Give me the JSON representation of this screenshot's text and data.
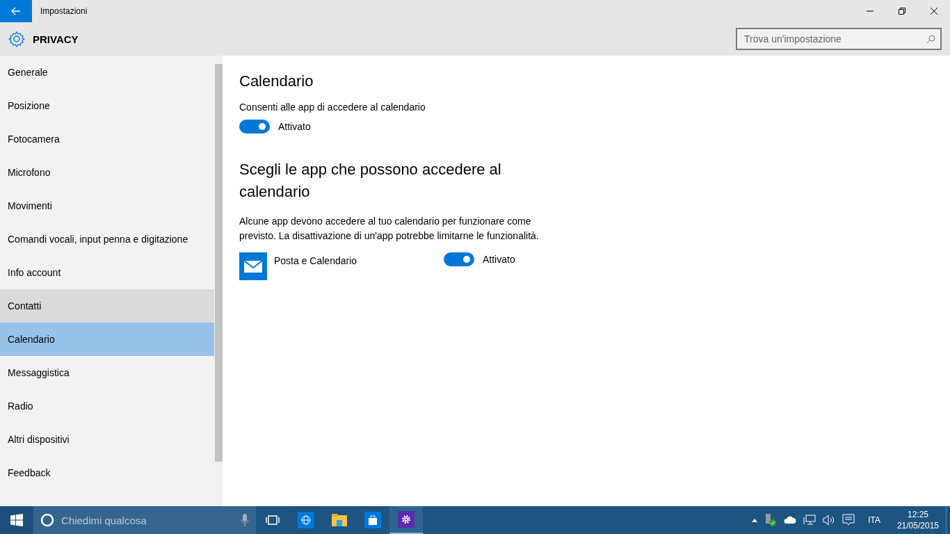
{
  "window": {
    "title": "Impostazioni"
  },
  "header": {
    "title": "PRIVACY",
    "search": {
      "placeholder": "Trova un'impostazione"
    }
  },
  "sidebar": {
    "items": [
      {
        "label": "Generale",
        "selected": false,
        "hovered": false
      },
      {
        "label": "Posizione",
        "selected": false,
        "hovered": false
      },
      {
        "label": "Fotocamera",
        "selected": false,
        "hovered": false
      },
      {
        "label": "Microfono",
        "selected": false,
        "hovered": false
      },
      {
        "label": "Movimenti",
        "selected": false,
        "hovered": false
      },
      {
        "label": "Comandi vocali, input penna e digitazione",
        "selected": false,
        "hovered": false
      },
      {
        "label": "Info account",
        "selected": false,
        "hovered": false
      },
      {
        "label": "Contatti",
        "selected": false,
        "hovered": true
      },
      {
        "label": "Calendario",
        "selected": true,
        "hovered": false
      },
      {
        "label": "Messaggistica",
        "selected": false,
        "hovered": false
      },
      {
        "label": "Radio",
        "selected": false,
        "hovered": false
      },
      {
        "label": "Altri dispositivi",
        "selected": false,
        "hovered": false
      },
      {
        "label": "Feedback",
        "selected": false,
        "hovered": false
      }
    ]
  },
  "content": {
    "title": "Calendario",
    "master": {
      "label": "Consenti alle app di accedere al calendario",
      "on": true,
      "state": "Attivato"
    },
    "subtitle": "Scegli le app che possono accedere al calendario",
    "description": "Alcune app devono accedere al tuo calendario per funzionare come previsto. La disattivazione di un'app potrebbe limitarne le funzionalità.",
    "apps": [
      {
        "name": "Posta e Calendario",
        "on": true,
        "state": "Attivato"
      }
    ]
  },
  "taskbar": {
    "search_placeholder": "Chiedimi qualcosa",
    "language": "ITA",
    "time": "12:25",
    "date": "21/05/2015"
  }
}
